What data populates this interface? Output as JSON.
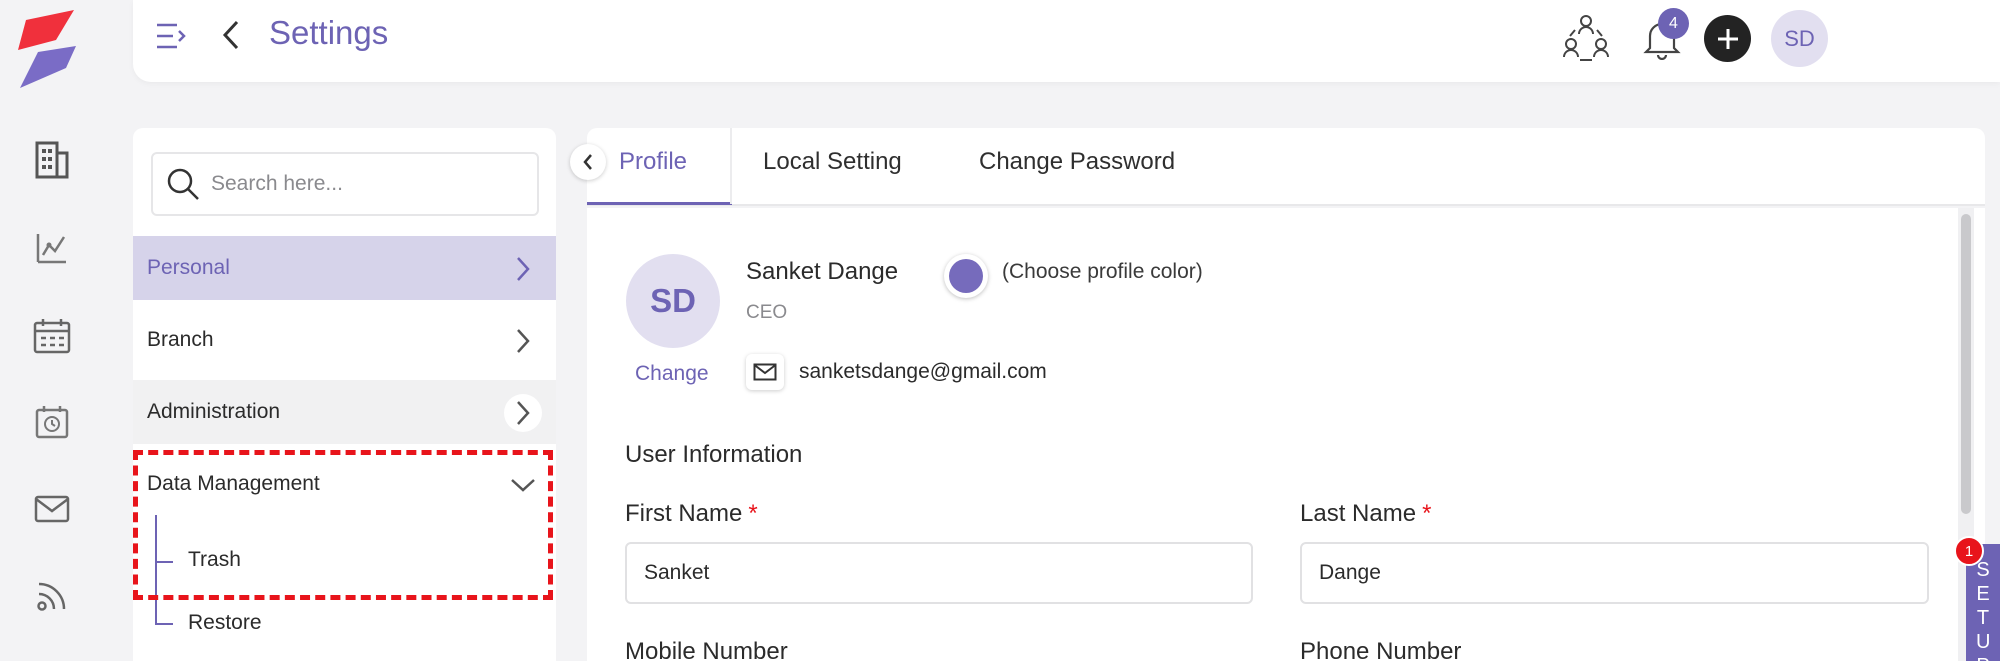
{
  "header": {
    "title": "Settings",
    "notification_count": "4",
    "user_initials": "SD"
  },
  "sidebar": {
    "search_placeholder": "Search here...",
    "items": [
      {
        "label": "Personal"
      },
      {
        "label": "Branch"
      },
      {
        "label": "Administration"
      },
      {
        "label": "Data Management"
      }
    ],
    "sub_items": [
      {
        "label": "Trash"
      },
      {
        "label": "Restore"
      }
    ]
  },
  "tabs": [
    {
      "label": "Profile"
    },
    {
      "label": "Local Setting"
    },
    {
      "label": "Change Password"
    }
  ],
  "profile": {
    "initials": "SD",
    "change_label": "Change",
    "name": "Sanket Dange",
    "role": "CEO",
    "color_label": "(Choose profile color)",
    "color": "#766bbc",
    "email": "sanketsdange@gmail.com"
  },
  "user_info": {
    "section_title": "User Information",
    "first_name_label": "First Name",
    "first_name_value": "Sanket",
    "last_name_label": "Last Name",
    "last_name_value": "Dange",
    "mobile_label": "Mobile Number",
    "phone_label": "Phone Number",
    "required_mark": "*"
  },
  "setup": {
    "label": "SETUP",
    "badge": "1"
  },
  "colors": {
    "accent": "#6d63b4",
    "highlight": "#e8141b"
  }
}
